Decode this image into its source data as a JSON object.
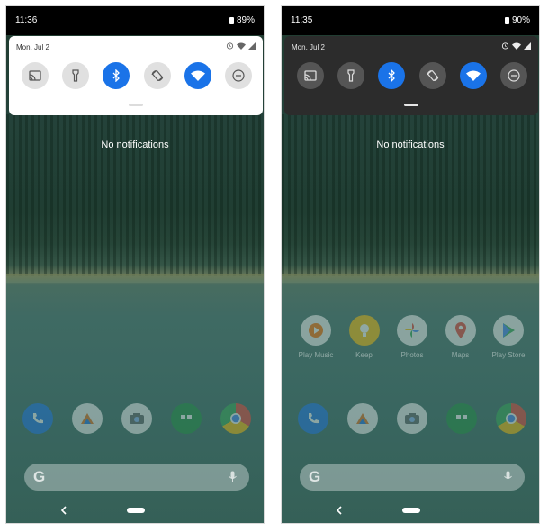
{
  "left": {
    "status_time": "11:36",
    "battery": "89%",
    "date": "Mon, Jul 2",
    "no_notifications": "No notifications",
    "theme": "light"
  },
  "right": {
    "status_time": "11:35",
    "battery": "90%",
    "date": "Mon, Jul 2",
    "no_notifications": "No notifications",
    "theme": "dark",
    "apps": [
      {
        "label": "Play Music",
        "icon": "play-music-icon"
      },
      {
        "label": "Keep",
        "icon": "keep-icon"
      },
      {
        "label": "Photos",
        "icon": "photos-icon"
      },
      {
        "label": "Maps",
        "icon": "maps-icon"
      },
      {
        "label": "Play Store",
        "icon": "play-store-icon"
      }
    ]
  },
  "quick_tiles": [
    {
      "name": "cast",
      "icon": "cast-icon",
      "active": false
    },
    {
      "name": "flashlight",
      "icon": "flashlight-icon",
      "active": false
    },
    {
      "name": "bluetooth",
      "icon": "bluetooth-icon",
      "active": true
    },
    {
      "name": "auto-rotate",
      "icon": "rotate-icon",
      "active": false
    },
    {
      "name": "wifi",
      "icon": "wifi-icon",
      "active": true
    },
    {
      "name": "do-not-disturb",
      "icon": "dnd-icon",
      "active": false
    }
  ],
  "dock": [
    {
      "name": "phone",
      "icon": "phone-icon"
    },
    {
      "name": "launcher",
      "icon": "triangle-app-icon"
    },
    {
      "name": "camera",
      "icon": "camera-icon"
    },
    {
      "name": "hangouts",
      "icon": "hangouts-icon"
    },
    {
      "name": "chrome",
      "icon": "chrome-icon"
    }
  ],
  "colors": {
    "accent": "#1a73e8",
    "panel_light": "#ffffff",
    "panel_dark": "#2c2c2c"
  }
}
